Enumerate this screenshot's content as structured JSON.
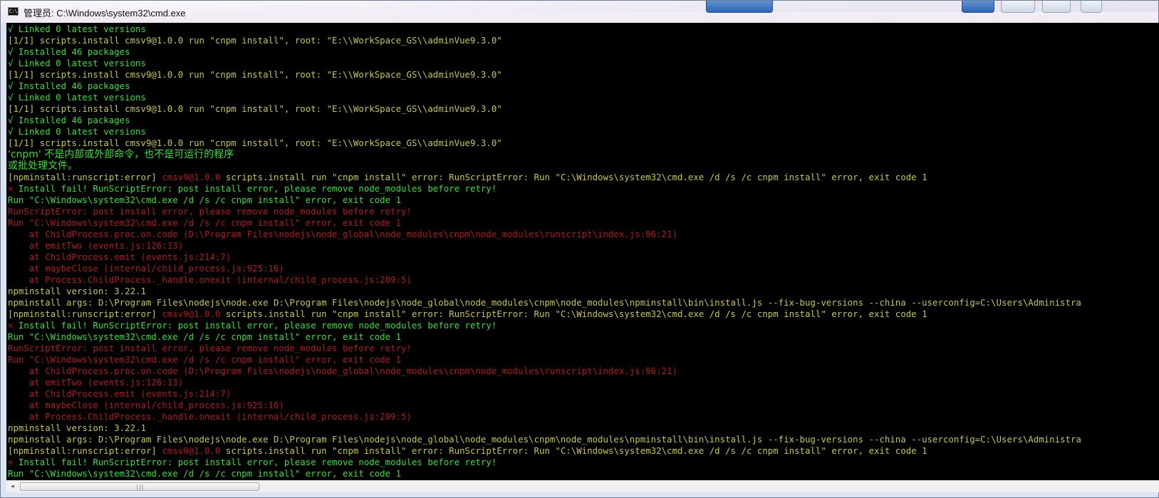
{
  "window": {
    "title": "管理员: C:\\Windows\\system32\\cmd.exe",
    "icon_label": "C:\\"
  },
  "colors": {
    "console_bg": "#000000",
    "text_yellow": "#c6c64e",
    "text_green": "#34e034",
    "text_red": "#b01c1c"
  },
  "console": {
    "lines": [
      {
        "color": "green",
        "text": "√ Linked 0 latest versions"
      },
      {
        "color": "yellow",
        "text": "[1/1] scripts.install cmsv9@1.0.0 run \"cnpm install\", root: \"E:\\\\WorkSpace_GS\\\\adminVue9.3.0\""
      },
      {
        "color": "green",
        "text": "√ Installed 46 packages"
      },
      {
        "color": "green",
        "text": "√ Linked 0 latest versions"
      },
      {
        "color": "yellow",
        "text": "[1/1] scripts.install cmsv9@1.0.0 run \"cnpm install\", root: \"E:\\\\WorkSpace_GS\\\\adminVue9.3.0\""
      },
      {
        "color": "green",
        "text": "√ Installed 46 packages"
      },
      {
        "color": "green",
        "text": "√ Linked 0 latest versions"
      },
      {
        "color": "yellow",
        "text": "[1/1] scripts.install cmsv9@1.0.0 run \"cnpm install\", root: \"E:\\\\WorkSpace_GS\\\\adminVue9.3.0\""
      },
      {
        "color": "green",
        "text": "√ Installed 46 packages"
      },
      {
        "color": "green",
        "text": "√ Linked 0 latest versions"
      },
      {
        "color": "yellow",
        "text": "[1/1] scripts.install cmsv9@1.0.0 run \"cnpm install\", root: \"E:\\\\WorkSpace_GS\\\\adminVue9.3.0\""
      },
      {
        "color": "cn",
        "text": "'cnpm' 不是内部或外部命令，也不是可运行的程序"
      },
      {
        "color": "cn",
        "text": "或批处理文件。"
      },
      {
        "color": "mixed",
        "prefix": "[npminstall:runscript:error] ",
        "red": "cmsv9@1.0.0",
        "suffix": " scripts.install run \"cnpm install\" error: RunScriptError: Run \"C:\\Windows\\system32\\cmd.exe /d /s /c cnpm install\" error, exit code 1"
      },
      {
        "color": "xgreen",
        "mark": "×",
        "text": " Install fail! RunScriptError: post install error, please remove node_modules before retry!"
      },
      {
        "color": "green",
        "text": "Run \"C:\\Windows\\system32\\cmd.exe /d /s /c cnpm install\" error, exit code 1"
      },
      {
        "color": "red",
        "text": "RunScriptError: post install error, please remove node_modules before retry!"
      },
      {
        "color": "red",
        "text": "Run \"C:\\Windows\\system32\\cmd.exe /d /s /c cnpm install\" error, exit code 1"
      },
      {
        "color": "red",
        "text": "    at ChildProcess.proc.on.code (D:\\Program Files\\nodejs\\node_global\\node_modules\\cnpm\\node_modules\\runscript\\index.js:96:21)"
      },
      {
        "color": "red",
        "text": "    at emitTwo (events.js:126:13)"
      },
      {
        "color": "red",
        "text": "    at ChildProcess.emit (events.js:214:7)"
      },
      {
        "color": "red",
        "text": "    at maybeClose (internal/child_process.js:925:16)"
      },
      {
        "color": "red",
        "text": "    at Process.ChildProcess._handle.onexit (internal/child_process.js:209:5)"
      },
      {
        "color": "yellow",
        "text": "npminstall version: 3.22.1"
      },
      {
        "color": "yellow",
        "text": "npminstall args: D:\\Program Files\\nodejs\\node.exe D:\\Program Files\\nodejs\\node_global\\node_modules\\cnpm\\node_modules\\npminstall\\bin\\install.js --fix-bug-versions --china --userconfig=C:\\Users\\Administra"
      },
      {
        "color": "mixed",
        "prefix": "[npminstall:runscript:error] ",
        "red": "cmsv9@1.0.0",
        "suffix": " scripts.install run \"cnpm install\" error: RunScriptError: Run \"C:\\Windows\\system32\\cmd.exe /d /s /c cnpm install\" error, exit code 1"
      },
      {
        "color": "xgreen",
        "mark": "×",
        "text": " Install fail! RunScriptError: post install error, please remove node_modules before retry!"
      },
      {
        "color": "green",
        "text": "Run \"C:\\Windows\\system32\\cmd.exe /d /s /c cnpm install\" error, exit code 1"
      },
      {
        "color": "red",
        "text": "RunScriptError: post install error, please remove node_modules before retry!"
      },
      {
        "color": "red",
        "text": "Run \"C:\\Windows\\system32\\cmd.exe /d /s /c cnpm install\" error, exit code 1"
      },
      {
        "color": "red",
        "text": "    at ChildProcess.proc.on.code (D:\\Program Files\\nodejs\\node_global\\node_modules\\cnpm\\node_modules\\runscript\\index.js:96:21)"
      },
      {
        "color": "red",
        "text": "    at emitTwo (events.js:126:13)"
      },
      {
        "color": "red",
        "text": "    at ChildProcess.emit (events.js:214:7)"
      },
      {
        "color": "red",
        "text": "    at maybeClose (internal/child_process.js:925:16)"
      },
      {
        "color": "red",
        "text": "    at Process.ChildProcess._handle.onexit (internal/child_process.js:209:5)"
      },
      {
        "color": "yellow",
        "text": "npminstall version: 3.22.1"
      },
      {
        "color": "yellow",
        "text": "npminstall args: D:\\Program Files\\nodejs\\node.exe D:\\Program Files\\nodejs\\node_global\\node_modules\\cnpm\\node_modules\\npminstall\\bin\\install.js --fix-bug-versions --china --userconfig=C:\\Users\\Administra"
      },
      {
        "color": "mixed",
        "prefix": "[npminstall:runscript:error] ",
        "red": "cmsv9@1.0.0",
        "suffix": " scripts.install run \"cnpm install\" error: RunScriptError: Run \"C:\\Windows\\system32\\cmd.exe /d /s /c cnpm install\" error, exit code 1"
      },
      {
        "color": "xgreen",
        "mark": "×",
        "text": " Install fail! RunScriptError: post install error, please remove node_modules before retry!"
      },
      {
        "color": "green",
        "text": "Run \"C:\\Windows\\system32\\cmd.exe /d /s /c cnpm install\" error, exit code 1"
      }
    ]
  },
  "scrollbar": {
    "left_arrow": "◂",
    "grip": "|||"
  }
}
